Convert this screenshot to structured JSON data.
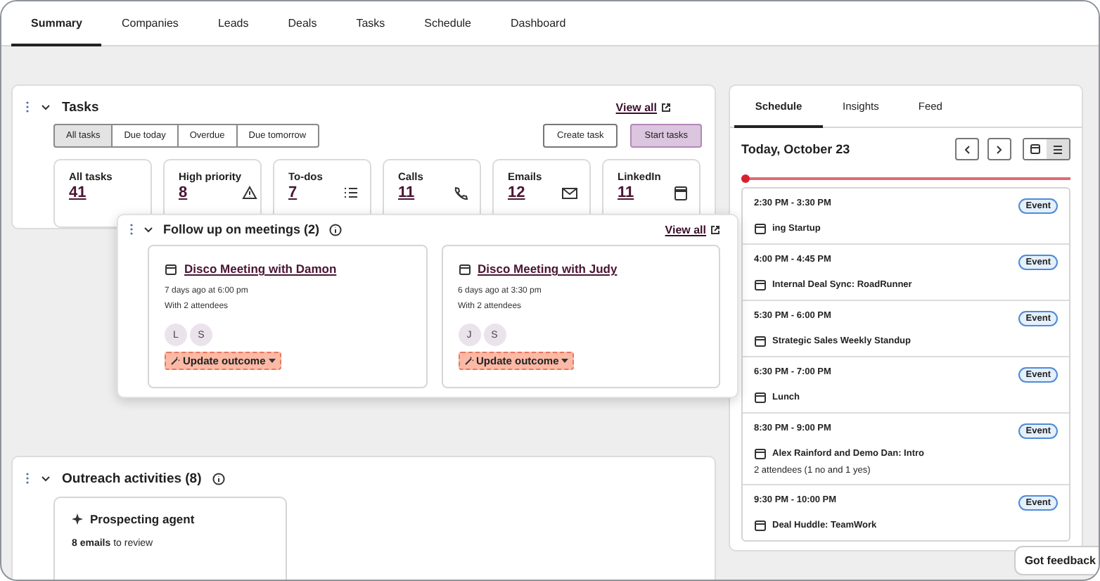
{
  "nav_tabs": [
    {
      "label": "Summary",
      "selected": true
    },
    {
      "label": "Companies",
      "selected": false
    },
    {
      "label": "Leads",
      "selected": false
    },
    {
      "label": "Deals",
      "selected": false
    },
    {
      "label": "Tasks",
      "selected": false
    },
    {
      "label": "Schedule",
      "selected": false
    },
    {
      "label": "Dashboard",
      "selected": false
    }
  ],
  "tasks": {
    "title": "Tasks",
    "view_all": "View all",
    "filters": [
      {
        "label": "All tasks",
        "selected": true
      },
      {
        "label": "Due today",
        "selected": false
      },
      {
        "label": "Overdue",
        "selected": false
      },
      {
        "label": "Due tomorrow",
        "selected": false
      }
    ],
    "actions": [
      {
        "label": "Create task",
        "kind": "secondary"
      },
      {
        "label": "Start tasks",
        "kind": "primary"
      }
    ],
    "stats": [
      {
        "label": "All tasks",
        "value": "41",
        "kind": "total"
      },
      {
        "label": "High priority",
        "value": "8",
        "kind": "priority"
      },
      {
        "label": "To-dos",
        "value": "7",
        "kind": "todo"
      },
      {
        "label": "Calls",
        "value": "11",
        "kind": "call"
      },
      {
        "label": "Emails",
        "value": "12",
        "kind": "email"
      },
      {
        "label": "LinkedIn",
        "value": "11",
        "kind": "linkedin"
      }
    ]
  },
  "follow_up": {
    "title": "Follow up on meetings (2)",
    "view_all": "View all",
    "meetings": [
      {
        "title": "Disco Meeting with Damon",
        "when": "7 days ago at 6:00 pm",
        "attendees": "With 2 attendees",
        "avatars": [
          "L",
          "S"
        ],
        "action": "Update outcome"
      },
      {
        "title": "Disco Meeting with Judy",
        "when": "6 days ago at 3:30 pm",
        "attendees": "With 2 attendees",
        "avatars": [
          "J",
          "S"
        ],
        "action": "Update outcome"
      }
    ]
  },
  "schedule": {
    "tabs": [
      {
        "label": "Schedule",
        "selected": true
      },
      {
        "label": "Insights",
        "selected": false
      },
      {
        "label": "Feed",
        "selected": false
      }
    ],
    "date": "Today, October 23",
    "views": [
      {
        "kind": "calendar",
        "selected": false
      },
      {
        "kind": "list",
        "selected": true
      }
    ],
    "events": [
      {
        "time": "2:30 PM - 3:30 PM",
        "title": "ing Startup",
        "badge": "Event"
      },
      {
        "time": "4:00 PM - 4:45 PM",
        "title": "Internal Deal Sync: RoadRunner",
        "badge": "Event"
      },
      {
        "time": "5:30 PM - 6:00 PM",
        "title": "Strategic Sales Weekly Standup",
        "badge": "Event"
      },
      {
        "time": "6:30 PM - 7:00 PM",
        "title": "Lunch",
        "badge": "Event"
      },
      {
        "time": "8:30 PM - 9:00 PM",
        "title": "Alex Rainford and Demo Dan: Intro",
        "details": "2 attendees (1 no and 1 yes)",
        "badge": "Event"
      },
      {
        "time": "9:30 PM - 10:00 PM",
        "title": "Deal Huddle: TeamWork",
        "badge": "Event"
      }
    ]
  },
  "outreach": {
    "title": "Outreach activities (8)",
    "agent": {
      "title": "Prospecting agent",
      "summary": "**8 emails** to review"
    }
  },
  "feedback": "Got feedback"
}
